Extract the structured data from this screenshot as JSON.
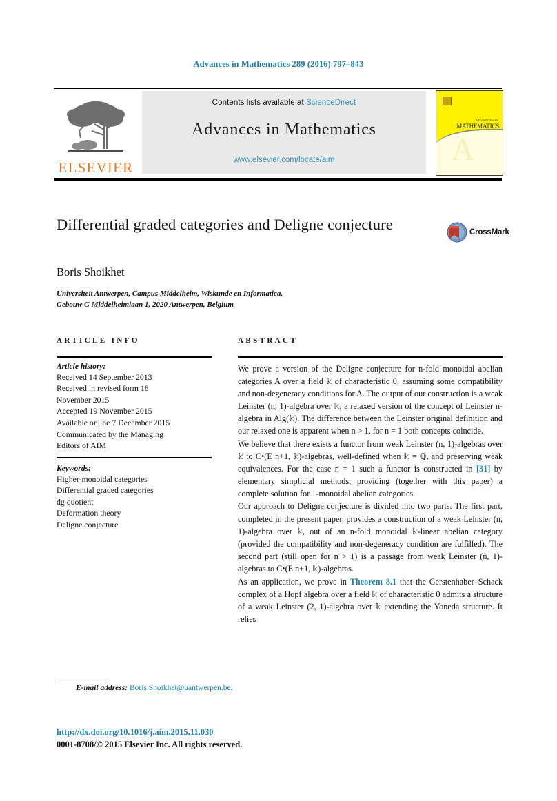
{
  "running_head": "Advances in Mathematics 289 (2016) 797–843",
  "masthead": {
    "contents_prefix": "Contents lists available at ",
    "sciencedirect_link": "ScienceDirect",
    "journal_title": "Advances in Mathematics",
    "journal_url": "www.elsevier.com/locate/aim",
    "publisher_name": "ELSEVIER",
    "cover": {
      "small_text": "ADVANCES IN",
      "big_text": "MATHEMATICS",
      "letter": "A"
    }
  },
  "article": {
    "title": "Differential graded categories and Deligne conjecture",
    "author": "Boris Shoikhet",
    "affiliation_line1": "Universiteit Antwerpen, Campus Middelheim, Wiskunde en Informatica,",
    "affiliation_line2": "Gebouw G Middelheimlaan 1, 2020 Antwerpen, Belgium",
    "crossmark_label": "CrossMark"
  },
  "info": {
    "heading": "ARTICLE INFO",
    "history_label": "Article history:",
    "history_lines": [
      "Received 14 September 2013",
      "Received in revised form 18",
      "November 2015",
      "Accepted 19 November 2015",
      "Available online 7 December 2015",
      "Communicated by the Managing",
      "Editors of AIM"
    ],
    "keywords_label": "Keywords:",
    "keywords": [
      "Higher-monoidal categories",
      "Differential graded categories",
      "dg quotient",
      "Deformation theory",
      "Deligne conjecture"
    ]
  },
  "abstract": {
    "heading": "ABSTRACT",
    "paragraphs": [
      "We prove a version of the Deligne conjecture for n-fold monoidal abelian categories A over a field 𝕜 of characteristic 0, assuming some compatibility and non-degeneracy conditions for A. The output of our construction is a weak Leinster (n, 1)-algebra over 𝕜, a relaxed version of the concept of Leinster n-algebra in Alg(𝕜). The difference between the Leinster original definition and our relaxed one is apparent when n > 1, for n = 1 both concepts coincide.",
      "We believe that there exists a functor from weak Leinster (n, 1)-algebras over 𝕜 to C•(E n+1, 𝕜)-algebras, well-defined when 𝕜 = ℚ, and preserving weak equivalences. For the case n = 1 such a functor is constructed in [31] by elementary simplicial methods, providing (together with this paper) a complete solution for 1-monoidal abelian categories.",
      "Our approach to Deligne conjecture is divided into two parts. The first part, completed in the present paper, provides a construction of a weak Leinster (n, 1)-algebra over 𝕜, out of an n-fold monoidal 𝕜-linear abelian category (provided the compatibility and non-degeneracy condition are fulfilled). The second part (still open for n > 1) is a passage from weak Leinster (n, 1)-algebras to C•(E n+1, 𝕜)-algebras.",
      "As an application, we prove in Theorem 8.1 that the Gerstenhaber–Schack complex of a Hopf algebra over a field 𝕜 of characteristic 0 admits a structure of a weak Leinster (2, 1)-algebra over 𝕜 extending the Yoneda structure. It relies"
    ],
    "inline_reference": "[31]",
    "inline_theorem": "Theorem 8.1"
  },
  "footer": {
    "email_label": "E-mail address:",
    "email_address": "Boris.Shoikhet@uantwerpen.be",
    "email_trailing": ".",
    "doi": "http://dx.doi.org/10.1016/j.aim.2015.11.030",
    "copyright": "0001-8708/© 2015 Elsevier Inc. All rights reserved."
  },
  "colors": {
    "link_blue": "#1a7fa8",
    "sciencedirect_blue": "#3a93b8",
    "elsevier_orange": "#E87722",
    "cover_yellow": "#FFF200"
  }
}
